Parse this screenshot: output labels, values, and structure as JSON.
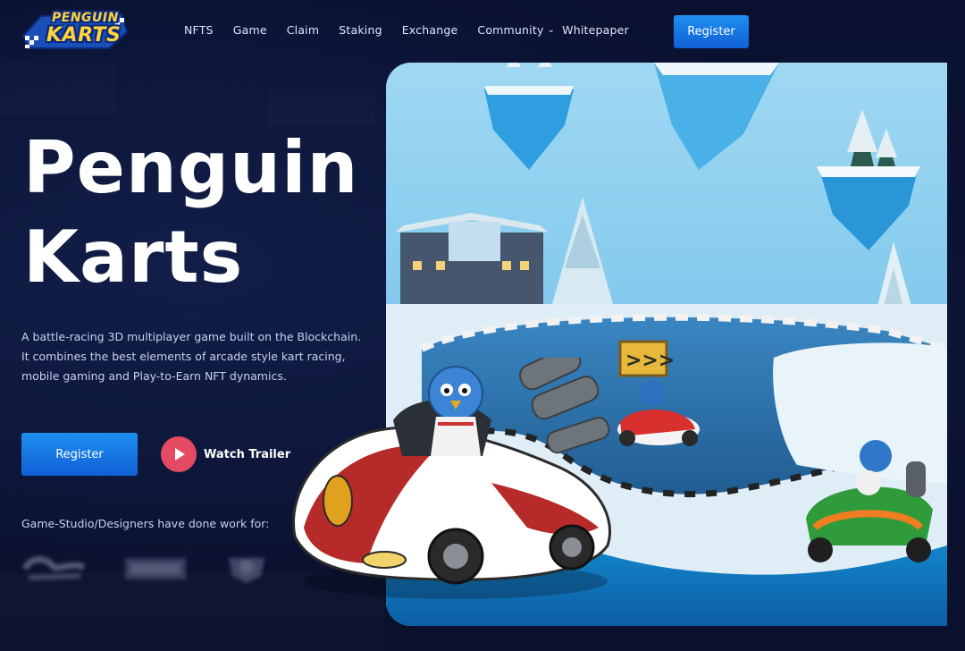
{
  "header": {
    "logo_line1": "PENGUIN",
    "logo_line2": "KARTS",
    "nav": [
      {
        "label": "NFTS"
      },
      {
        "label": "Game"
      },
      {
        "label": "Claim"
      },
      {
        "label": "Staking"
      },
      {
        "label": "Exchange"
      },
      {
        "label": "Community",
        "has_dropdown": true
      },
      {
        "label": "Whitepaper"
      }
    ],
    "register_label": "Register"
  },
  "hero": {
    "title_line1": "Penguin",
    "title_line2": "Karts",
    "description": "A battle-racing 3D multiplayer game built on the Blockchain. It combines the best elements of arcade style kart racing, mobile gaming and Play-to-Earn NFT dynamics.",
    "register_label": "Register",
    "trailer_label": "Watch Trailer",
    "studio_label": "Game-Studio/Designers have done work for:"
  },
  "colors": {
    "background": "#0b1230",
    "accent_blue": "#1877e6",
    "play_red": "#e44a63"
  }
}
